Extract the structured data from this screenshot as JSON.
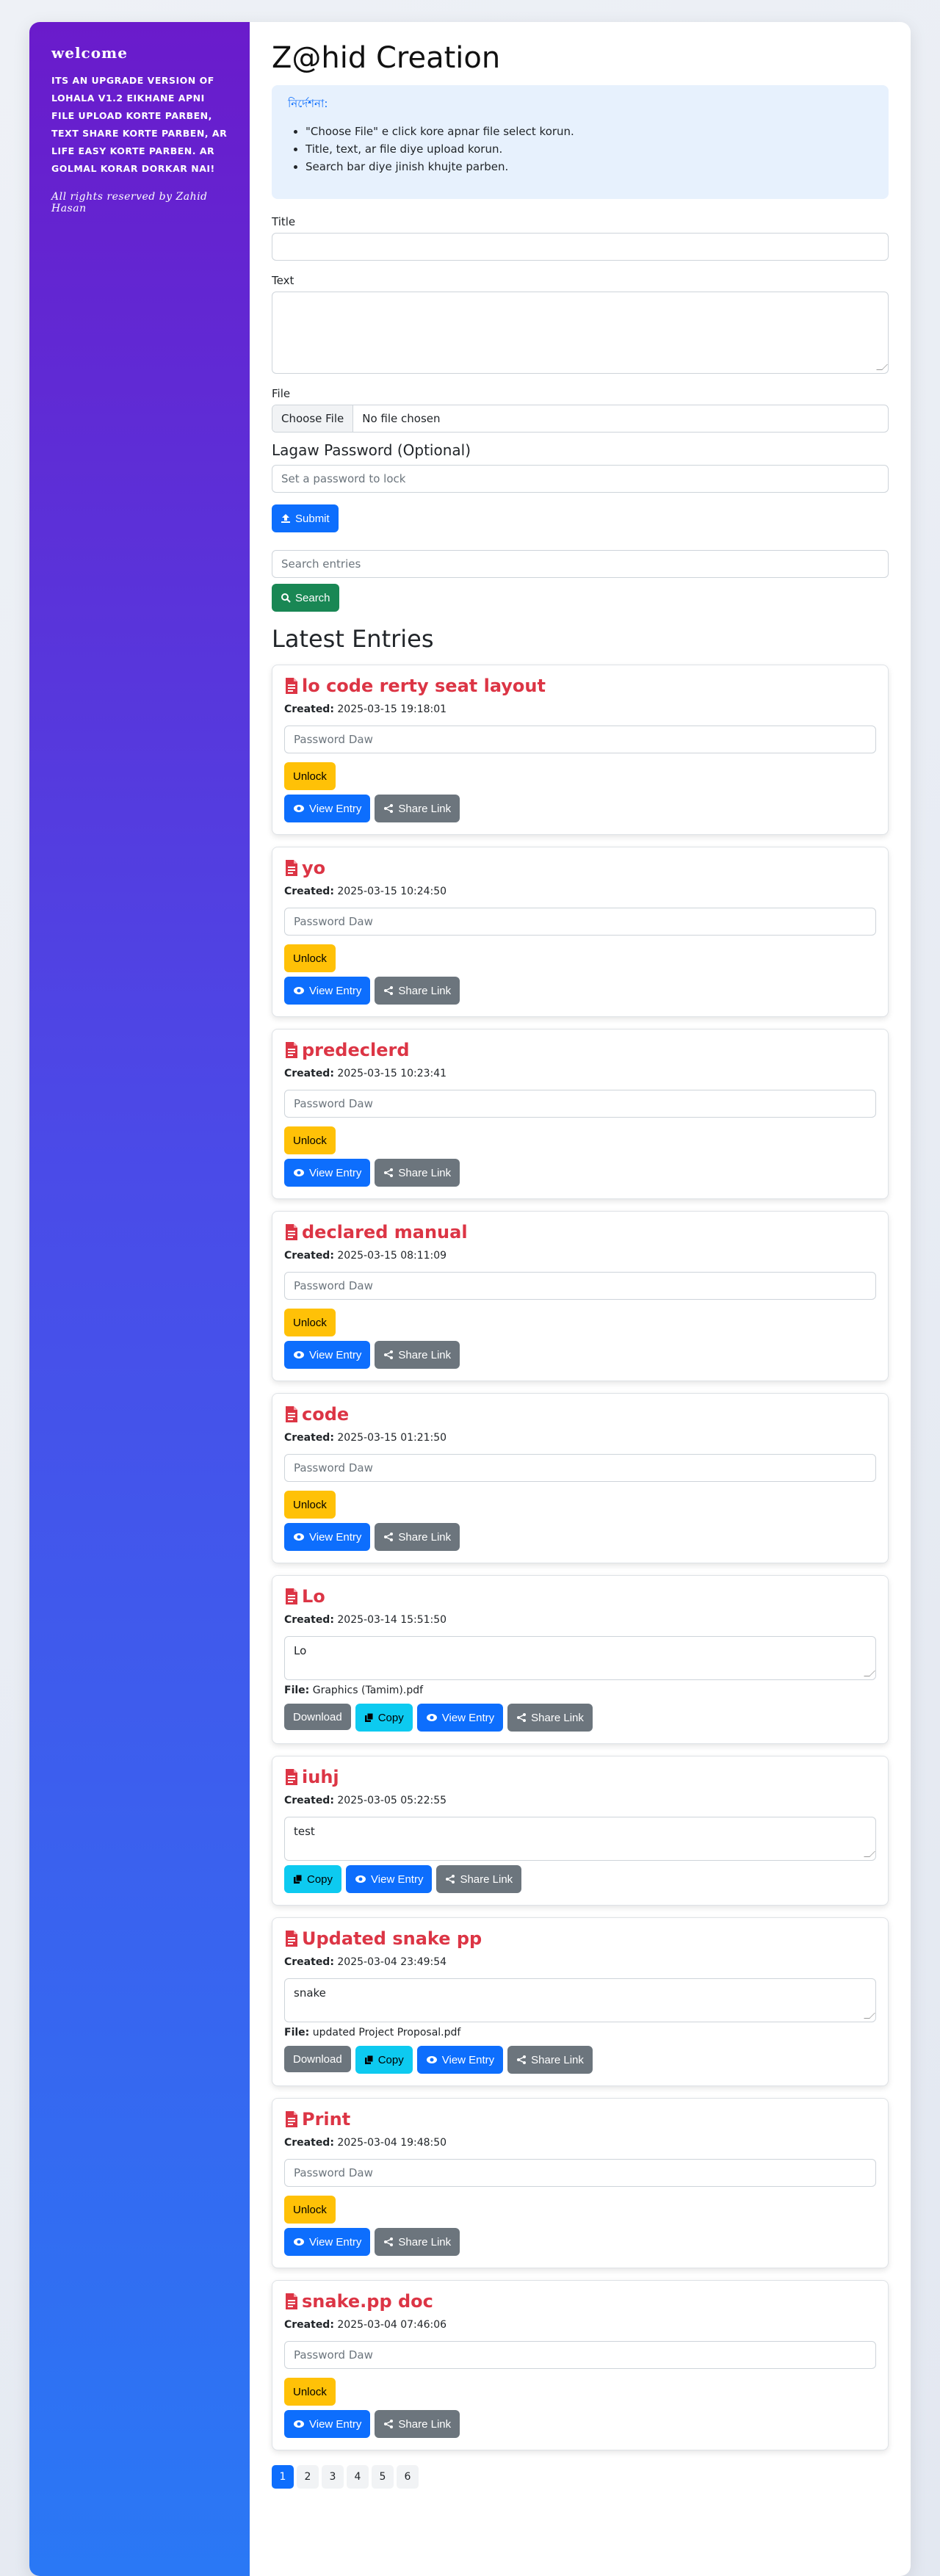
{
  "sidebar": {
    "title": "welcome",
    "text": "its an upgrade version of lohala v1.2 eikhane apni file upload korte parben, text share korte parben, ar life easy korte parben. ar golmal korar dorkar nai!",
    "footer": "All rights reserved by Zahid Hasan"
  },
  "site_title": "Z@hid Creation",
  "alert": {
    "title": "নির্দেশনা:",
    "items": [
      "\"Choose File\" e click kore apnar file select korun.",
      "Title, text, ar file diye upload korun.",
      "Search bar diye jinish khujte parben."
    ]
  },
  "form": {
    "title_label": "Title",
    "text_label": "Text",
    "file_label": "File",
    "choose_file": "Choose File",
    "no_file": "No file chosen",
    "password_label": "Lagaw Password (Optional)",
    "password_placeholder": "Set a password to lock",
    "submit": "Submit"
  },
  "search": {
    "placeholder": "Search entries",
    "button": "Search"
  },
  "latest_heading": "Latest Entries",
  "labels": {
    "created": "Created:",
    "file": "File:",
    "unlock": "Unlock",
    "view": "View Entry",
    "share": "Share Link",
    "download": "Download",
    "copy": "Copy",
    "password_placeholder": "Password Daw"
  },
  "entries": [
    {
      "title": "lo code rerty seat layout",
      "created": "2025-03-15 19:18:01",
      "type": "locked"
    },
    {
      "title": "yo",
      "created": "2025-03-15 10:24:50",
      "type": "locked"
    },
    {
      "title": "predeclerd",
      "created": "2025-03-15 10:23:41",
      "type": "locked"
    },
    {
      "title": "declared manual",
      "created": "2025-03-15 08:11:09",
      "type": "locked"
    },
    {
      "title": "code",
      "created": "2025-03-15 01:21:50",
      "type": "locked"
    },
    {
      "title": "Lo",
      "created": "2025-03-14 15:51:50",
      "type": "file",
      "text": "Lo",
      "file": "Graphics (Tamim).pdf"
    },
    {
      "title": "iuhj",
      "created": "2025-03-05 05:22:55",
      "type": "text",
      "text": "test"
    },
    {
      "title": "Updated snake pp",
      "created": "2025-03-04 23:49:54",
      "type": "file",
      "text": "snake",
      "file": "updated Project Proposal.pdf"
    },
    {
      "title": "Print",
      "created": "2025-03-04 19:48:50",
      "type": "locked"
    },
    {
      "title": "snake.pp doc",
      "created": "2025-03-04 07:46:06",
      "type": "locked"
    }
  ],
  "pagination": [
    "1",
    "2",
    "3",
    "4",
    "5",
    "6"
  ],
  "colors": {
    "accent": "#0d6efd",
    "danger": "#dc3545",
    "success": "#198754",
    "warning": "#ffc107",
    "info": "#0dcaf0",
    "secondary": "#6c757d"
  }
}
